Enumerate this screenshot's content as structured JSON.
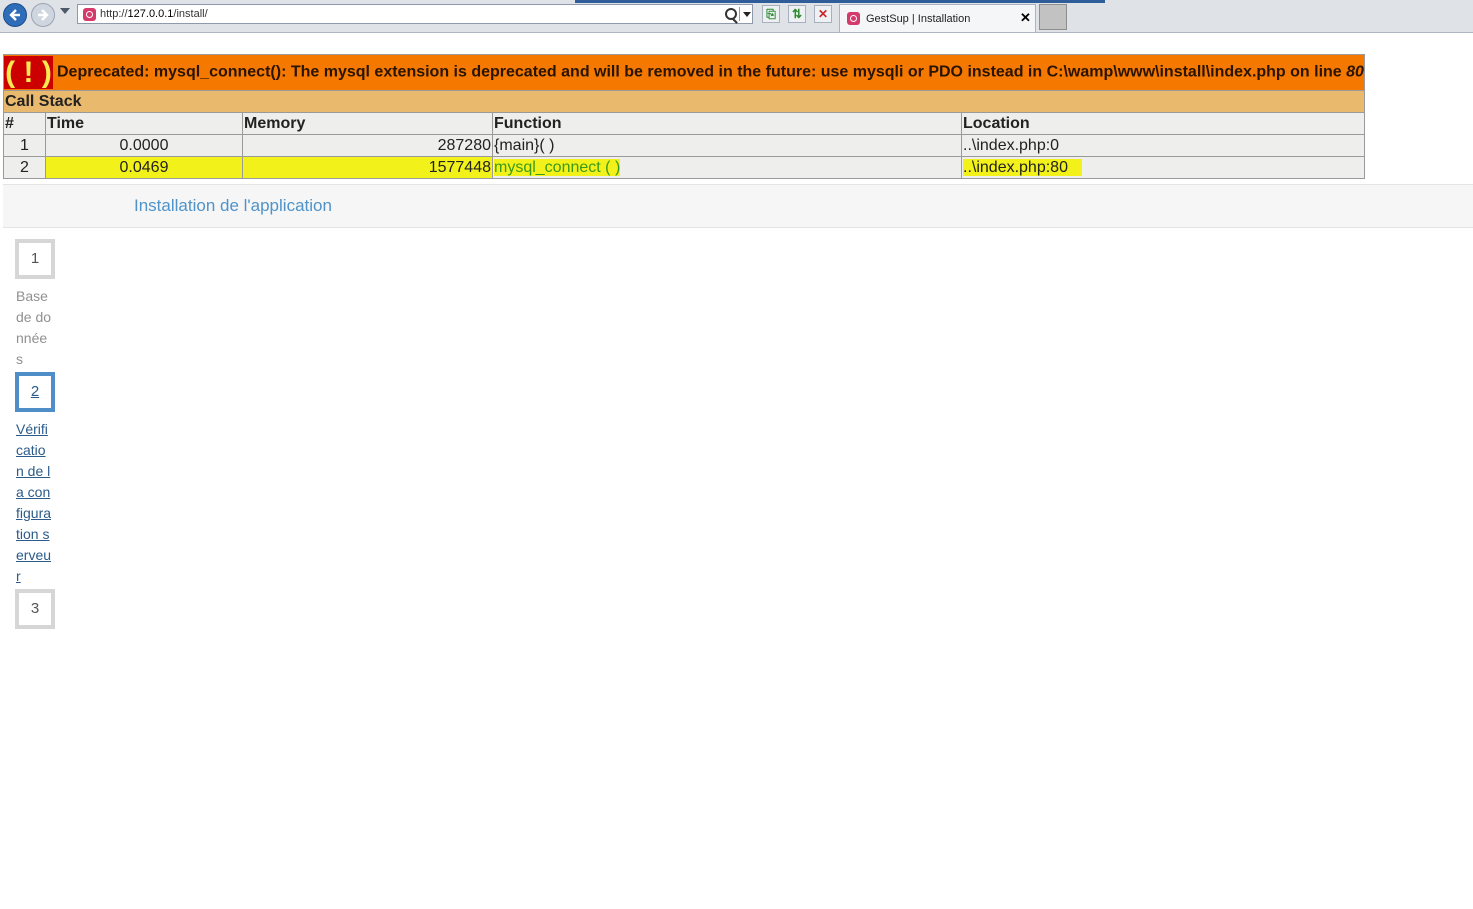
{
  "browser": {
    "url_prefix": "http://",
    "url_host": "127.0.0.1",
    "url_path": "/install/",
    "tab_title": "GestSup | Installation",
    "tab_close": "✕"
  },
  "xdebug": {
    "icon": "( ! )",
    "message": "Deprecated: mysql_connect(): The mysql extension is deprecated and will be removed in the future: use mysqli or PDO instead in C:\\wamp\\www\\install\\index.php on line ",
    "line": "80",
    "call_stack_label": "Call Stack",
    "headers": [
      "#",
      "Time",
      "Memory",
      "Function",
      "Location"
    ],
    "rows": [
      {
        "num": "1",
        "time": "0.0000",
        "memory": "287280",
        "function": "{main}( )",
        "location": "..\\index.php:0"
      },
      {
        "num": "2",
        "time": "0.0469",
        "memory": "1577448",
        "function": "mysql_connect ( )",
        "location": "..\\index.php:80"
      }
    ],
    "highlight_color": "#f2f21a"
  },
  "page": {
    "title": "Installation de l'application",
    "steps": [
      {
        "number": "1",
        "label": "Base de données",
        "state": "done"
      },
      {
        "number": "2",
        "label": "Vérification de la configuration serveur",
        "state": "active"
      },
      {
        "number": "3",
        "label": "",
        "state": "pending"
      }
    ]
  },
  "colors": {
    "error_bg": "#f57900",
    "icon_bg": "#cc0000",
    "callstack_bg": "#e9b96e",
    "accent": "#4f93c9"
  }
}
